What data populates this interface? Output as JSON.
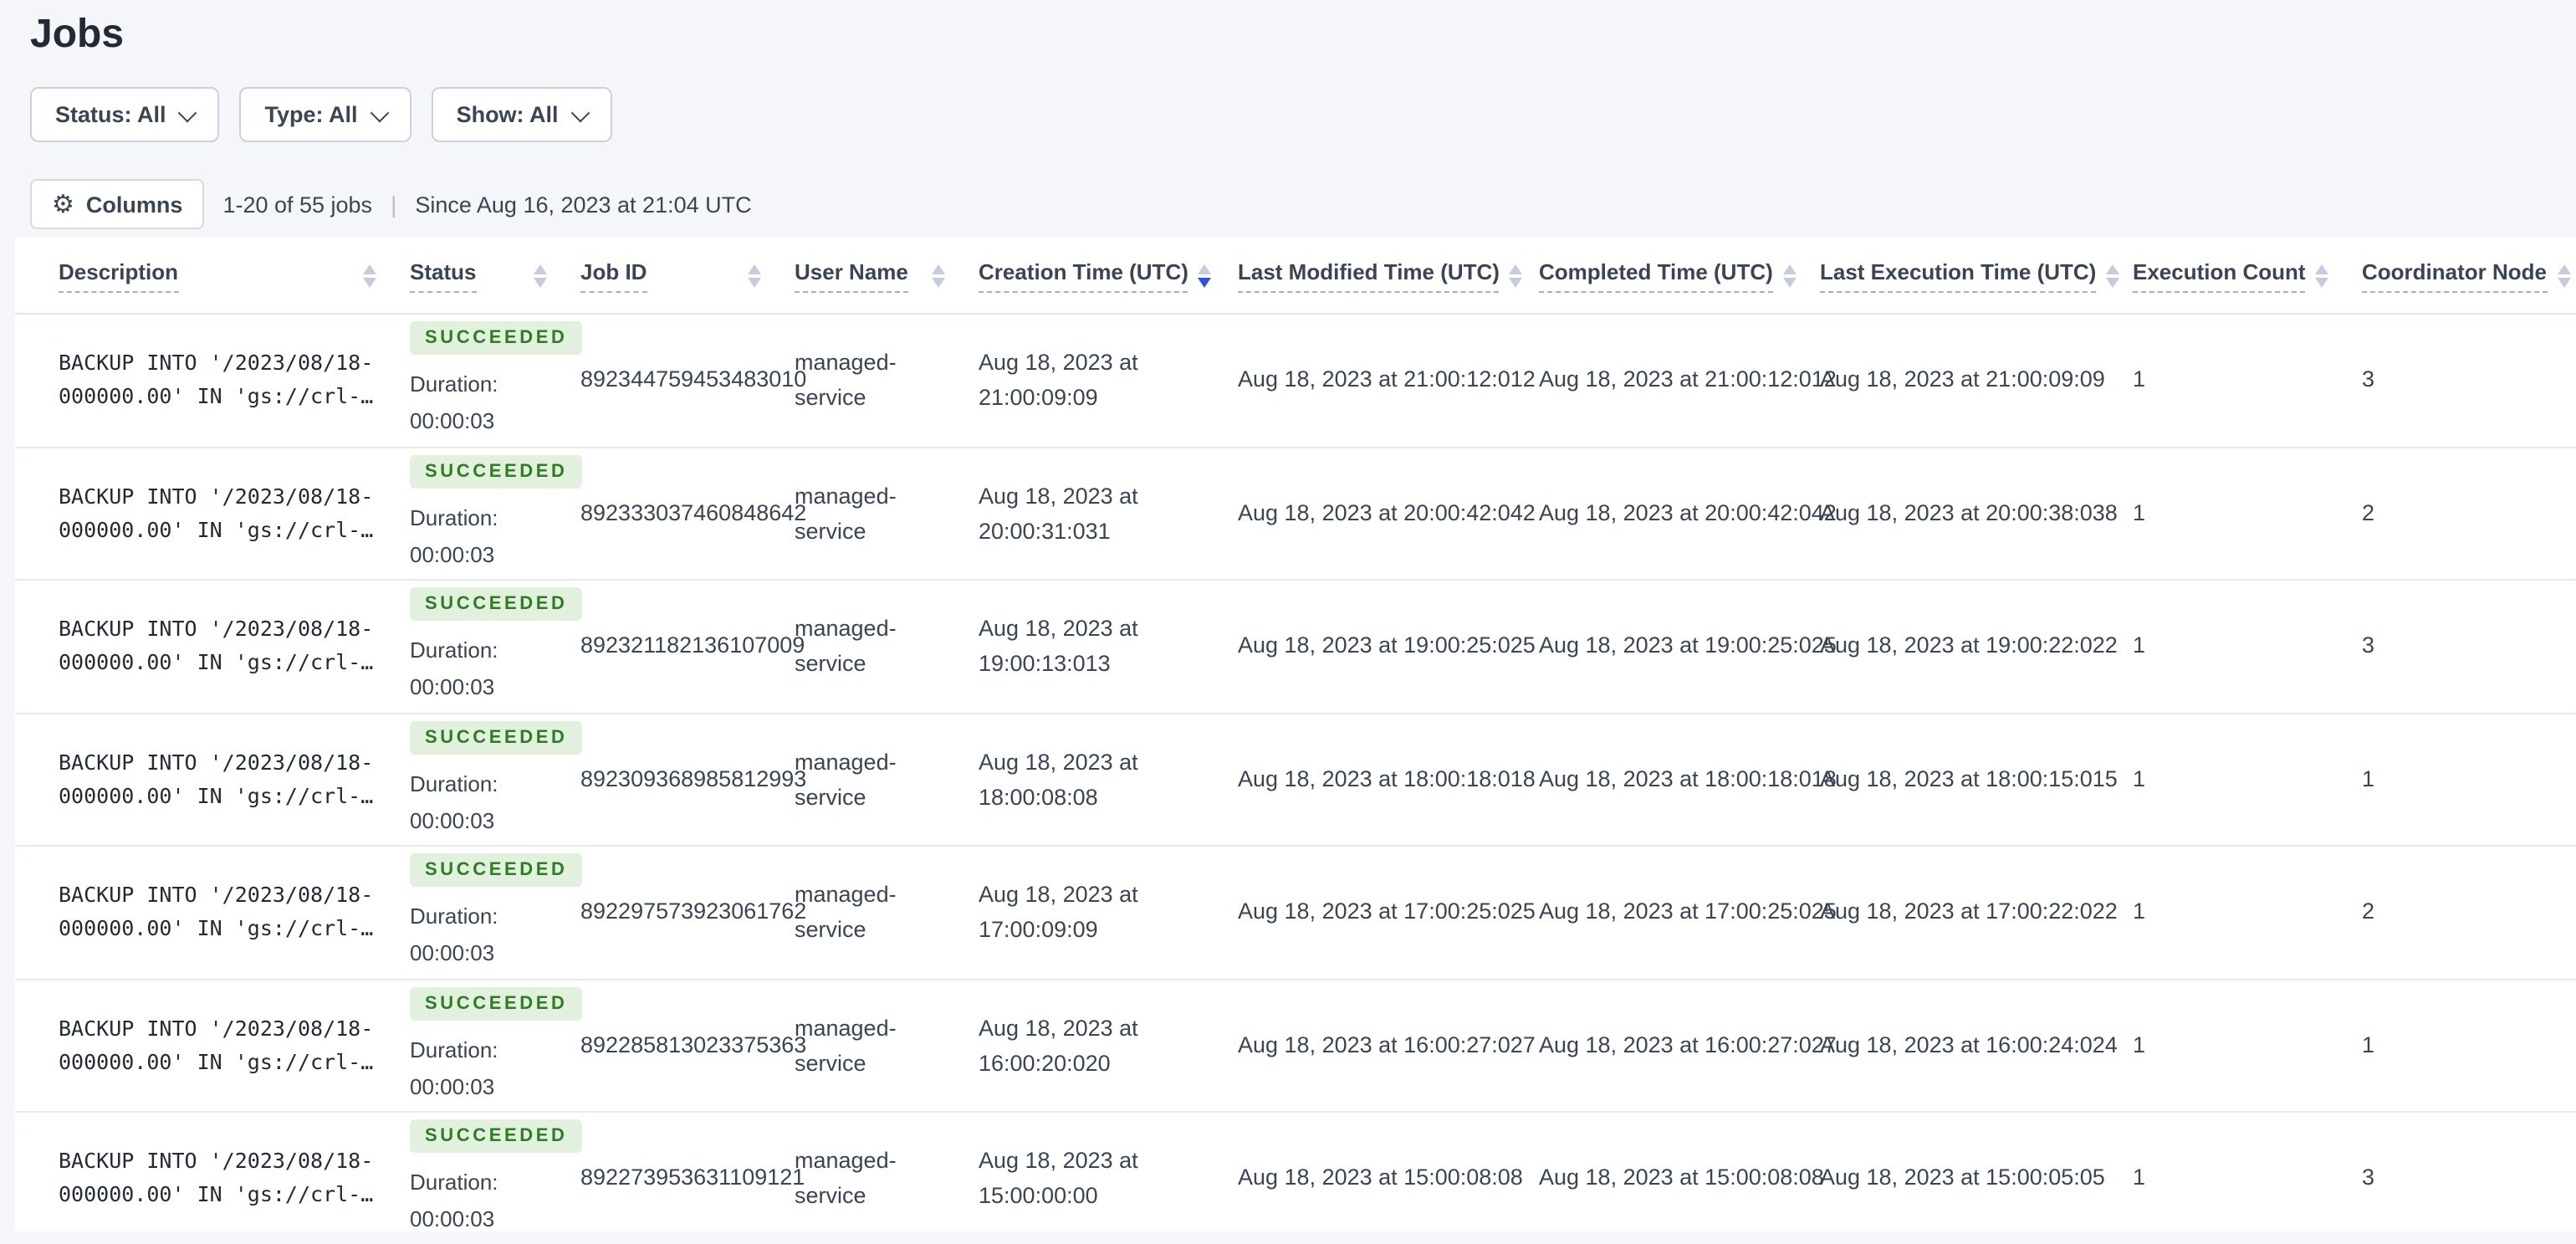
{
  "page_title": "Jobs",
  "filters": [
    {
      "label": "Status: All"
    },
    {
      "label": "Type: All"
    },
    {
      "label": "Show: All"
    }
  ],
  "toolbar": {
    "columns_label": "Columns",
    "range_text": "1-20 of 55 jobs",
    "divider": "|",
    "since_text": "Since Aug 16, 2023 at 21:04 UTC"
  },
  "colors": {
    "page_background": "#F4F6FA",
    "panel_background": "#FFFFFF",
    "sort_active": "#2B50E3",
    "badge_background": "#E2F1DE",
    "badge_text": "#2E7D23"
  },
  "table": {
    "columns": [
      {
        "label": "Description",
        "sort": "none"
      },
      {
        "label": "Status",
        "sort": "none"
      },
      {
        "label": "Job ID",
        "sort": "none"
      },
      {
        "label": "User Name",
        "sort": "none"
      },
      {
        "label": "Creation Time (UTC)",
        "sort": "desc"
      },
      {
        "label": "Last Modified Time (UTC)",
        "sort": "none"
      },
      {
        "label": "Completed Time (UTC)",
        "sort": "none"
      },
      {
        "label": "Last Execution Time (UTC)",
        "sort": "none"
      },
      {
        "label": "Execution Count",
        "sort": "none"
      },
      {
        "label": "Coordinator Node",
        "sort": "none"
      }
    ],
    "rows": [
      {
        "description": "BACKUP INTO '/2023/08/18-000000.00' IN 'gs://crl-…",
        "status": "SUCCEEDED",
        "duration_label": "Duration:",
        "duration_value": "00:00:03",
        "job_id": "892344759453483010",
        "user_name": "managed-service",
        "creation_time": "Aug 18, 2023 at 21:00:09:09",
        "last_modified_time": "Aug 18, 2023 at 21:00:12:012",
        "completed_time": "Aug 18, 2023 at 21:00:12:012",
        "last_execution_time": "Aug 18, 2023 at 21:00:09:09",
        "execution_count": "1",
        "coordinator_node": "3"
      },
      {
        "description": "BACKUP INTO '/2023/08/18-000000.00' IN 'gs://crl-…",
        "status": "SUCCEEDED",
        "duration_label": "Duration:",
        "duration_value": "00:00:03",
        "job_id": "892333037460848642",
        "user_name": "managed-service",
        "creation_time": "Aug 18, 2023 at 20:00:31:031",
        "last_modified_time": "Aug 18, 2023 at 20:00:42:042",
        "completed_time": "Aug 18, 2023 at 20:00:42:042",
        "last_execution_time": "Aug 18, 2023 at 20:00:38:038",
        "execution_count": "1",
        "coordinator_node": "2"
      },
      {
        "description": "BACKUP INTO '/2023/08/18-000000.00' IN 'gs://crl-…",
        "status": "SUCCEEDED",
        "duration_label": "Duration:",
        "duration_value": "00:00:03",
        "job_id": "892321182136107009",
        "user_name": "managed-service",
        "creation_time": "Aug 18, 2023 at 19:00:13:013",
        "last_modified_time": "Aug 18, 2023 at 19:00:25:025",
        "completed_time": "Aug 18, 2023 at 19:00:25:025",
        "last_execution_time": "Aug 18, 2023 at 19:00:22:022",
        "execution_count": "1",
        "coordinator_node": "3"
      },
      {
        "description": "BACKUP INTO '/2023/08/18-000000.00' IN 'gs://crl-…",
        "status": "SUCCEEDED",
        "duration_label": "Duration:",
        "duration_value": "00:00:03",
        "job_id": "892309368985812993",
        "user_name": "managed-service",
        "creation_time": "Aug 18, 2023 at 18:00:08:08",
        "last_modified_time": "Aug 18, 2023 at 18:00:18:018",
        "completed_time": "Aug 18, 2023 at 18:00:18:018",
        "last_execution_time": "Aug 18, 2023 at 18:00:15:015",
        "execution_count": "1",
        "coordinator_node": "1"
      },
      {
        "description": "BACKUP INTO '/2023/08/18-000000.00' IN 'gs://crl-…",
        "status": "SUCCEEDED",
        "duration_label": "Duration:",
        "duration_value": "00:00:03",
        "job_id": "892297573923061762",
        "user_name": "managed-service",
        "creation_time": "Aug 18, 2023 at 17:00:09:09",
        "last_modified_time": "Aug 18, 2023 at 17:00:25:025",
        "completed_time": "Aug 18, 2023 at 17:00:25:025",
        "last_execution_time": "Aug 18, 2023 at 17:00:22:022",
        "execution_count": "1",
        "coordinator_node": "2"
      },
      {
        "description": "BACKUP INTO '/2023/08/18-000000.00' IN 'gs://crl-…",
        "status": "SUCCEEDED",
        "duration_label": "Duration:",
        "duration_value": "00:00:03",
        "job_id": "892285813023375363",
        "user_name": "managed-service",
        "creation_time": "Aug 18, 2023 at 16:00:20:020",
        "last_modified_time": "Aug 18, 2023 at 16:00:27:027",
        "completed_time": "Aug 18, 2023 at 16:00:27:027",
        "last_execution_time": "Aug 18, 2023 at 16:00:24:024",
        "execution_count": "1",
        "coordinator_node": "1"
      },
      {
        "description": "BACKUP INTO '/2023/08/18-000000.00' IN 'gs://crl-…",
        "status": "SUCCEEDED",
        "duration_label": "Duration:",
        "duration_value": "00:00:03",
        "job_id": "892273953631109121",
        "user_name": "managed-service",
        "creation_time": "Aug 18, 2023 at 15:00:00:00",
        "last_modified_time": "Aug 18, 2023 at 15:00:08:08",
        "completed_time": "Aug 18, 2023 at 15:00:08:08",
        "last_execution_time": "Aug 18, 2023 at 15:00:05:05",
        "execution_count": "1",
        "coordinator_node": "3"
      }
    ]
  }
}
